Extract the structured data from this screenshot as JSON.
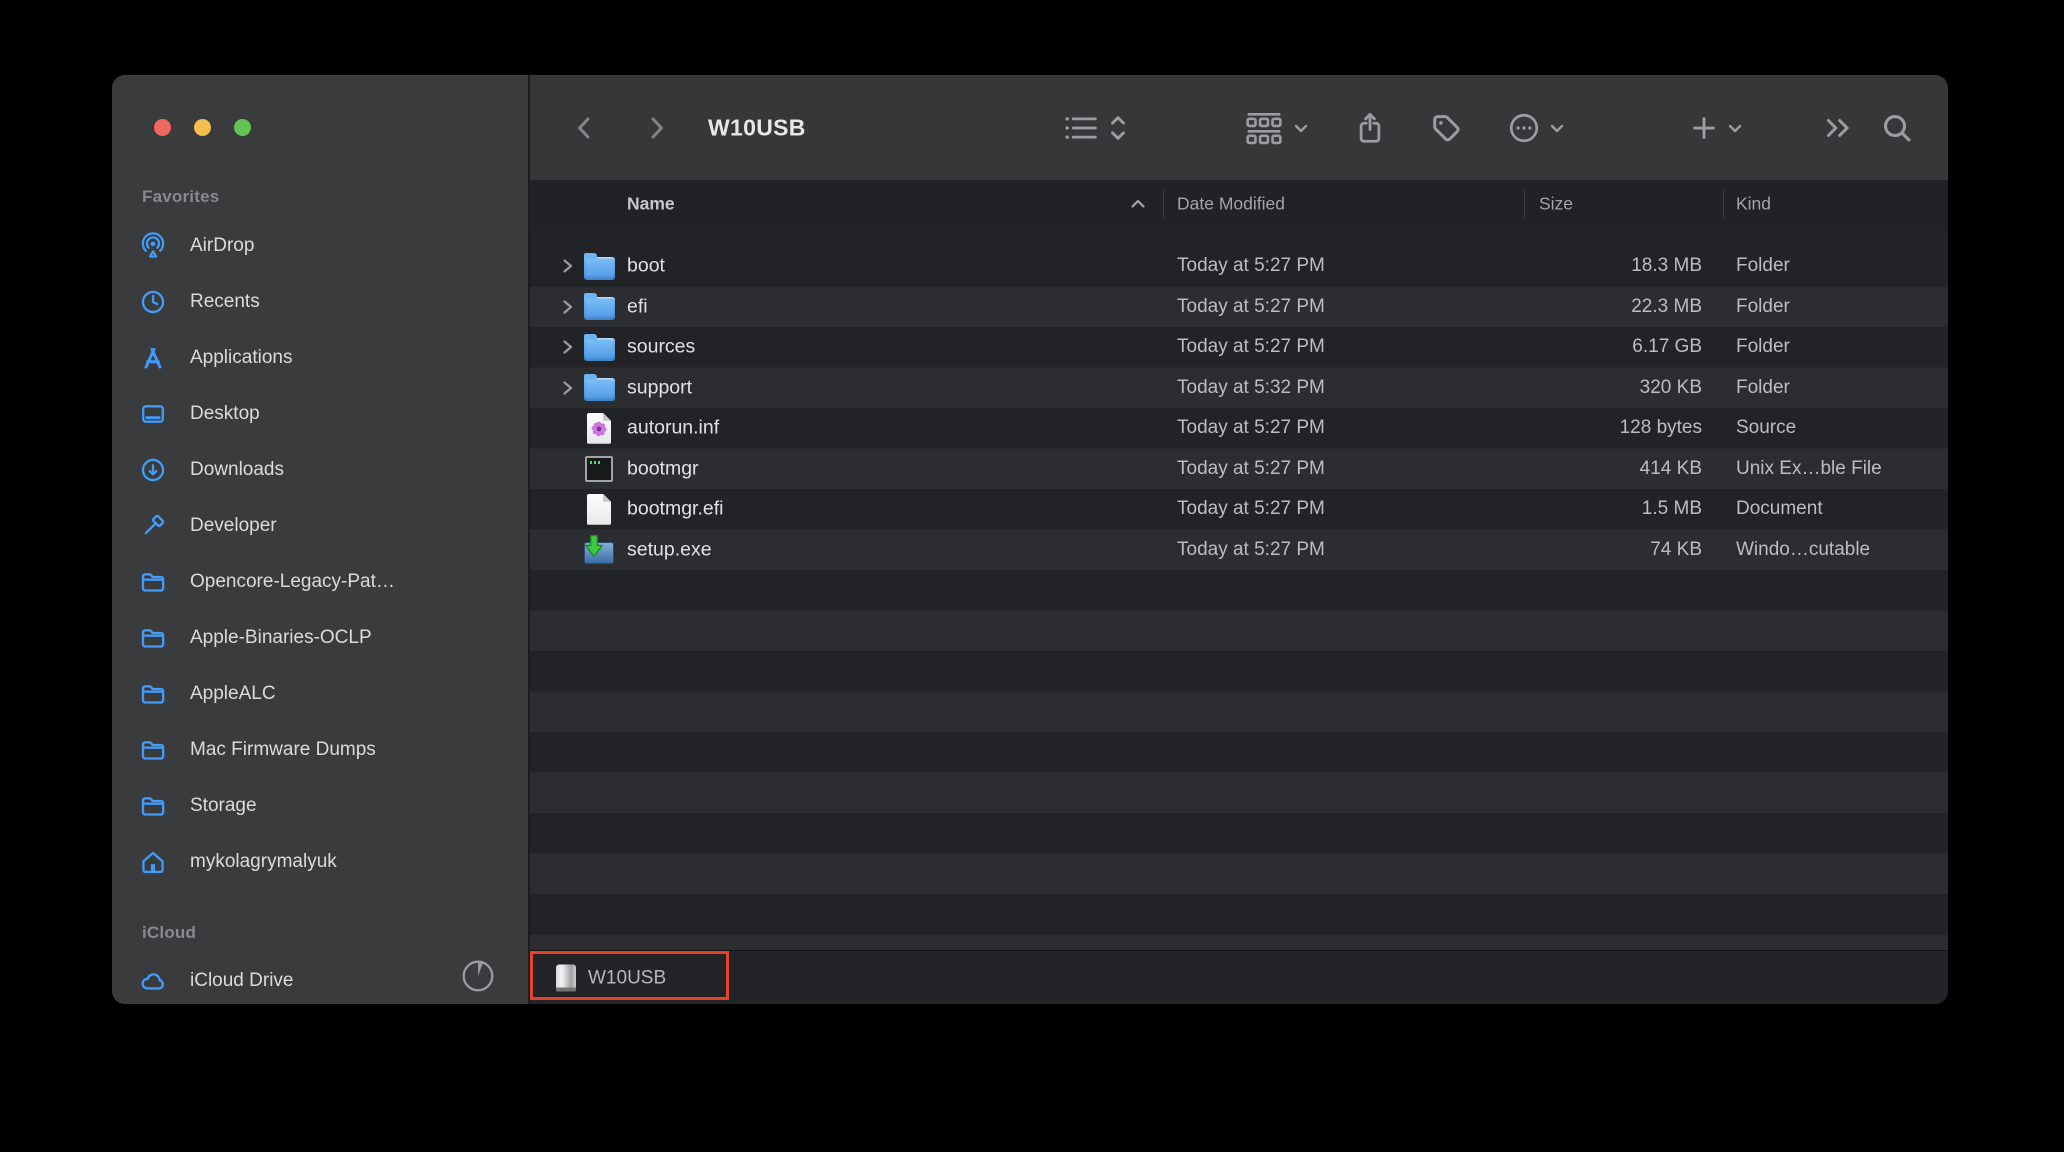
{
  "window": {
    "app": "Finder",
    "title": "W10USB"
  },
  "colors": {
    "accent-blue": "#419bf9",
    "annotation-red": "#e8432a",
    "traffic-red": "#ec6b5e",
    "traffic-yellow": "#f4bf50",
    "traffic-green": "#61c554",
    "folder-blue-top": "#7ec0f5",
    "folder-blue-bottom": "#4b97e6"
  },
  "toolbar": {
    "title": "W10USB",
    "controls": [
      "back",
      "forward",
      "view-list",
      "group-by",
      "share",
      "tag",
      "more-actions",
      "new-item",
      "overflow",
      "search"
    ]
  },
  "sidebar": {
    "sections": [
      {
        "header": "Favorites",
        "items": [
          {
            "label": "AirDrop",
            "icon": "airdrop-icon"
          },
          {
            "label": "Recents",
            "icon": "clock-icon"
          },
          {
            "label": "Applications",
            "icon": "appstore-icon"
          },
          {
            "label": "Desktop",
            "icon": "desktop-icon"
          },
          {
            "label": "Downloads",
            "icon": "download-circle-icon"
          },
          {
            "label": "Developer",
            "icon": "hammer-icon"
          },
          {
            "label": "Opencore-Legacy-Pat…",
            "icon": "folder-icon"
          },
          {
            "label": "Apple-Binaries-OCLP",
            "icon": "folder-icon"
          },
          {
            "label": "AppleALC",
            "icon": "folder-icon"
          },
          {
            "label": "Mac Firmware Dumps",
            "icon": "folder-icon"
          },
          {
            "label": "Storage",
            "icon": "folder-icon"
          },
          {
            "label": "mykolagrymalyuk",
            "icon": "home-icon"
          }
        ]
      },
      {
        "header": "iCloud",
        "items": [
          {
            "label": "iCloud Drive",
            "icon": "cloud-icon",
            "trailing": "sync-progress-icon"
          }
        ]
      }
    ]
  },
  "list": {
    "columns": [
      "Name",
      "Date Modified",
      "Size",
      "Kind"
    ],
    "sort": {
      "column": "Name",
      "direction": "ascending"
    },
    "rows": [
      {
        "name": "boot",
        "icon": "folder",
        "expandable": true,
        "date": "Today at 5:27 PM",
        "size": "18.3 MB",
        "kind": "Folder"
      },
      {
        "name": "efi",
        "icon": "folder",
        "expandable": true,
        "date": "Today at 5:27 PM",
        "size": "22.3 MB",
        "kind": "Folder"
      },
      {
        "name": "sources",
        "icon": "folder",
        "expandable": true,
        "date": "Today at 5:27 PM",
        "size": "6.17 GB",
        "kind": "Folder"
      },
      {
        "name": "support",
        "icon": "folder",
        "expandable": true,
        "date": "Today at 5:32 PM",
        "size": "320 KB",
        "kind": "Folder"
      },
      {
        "name": "autorun.inf",
        "icon": "inf-file",
        "expandable": false,
        "date": "Today at 5:27 PM",
        "size": "128 bytes",
        "kind": "Source"
      },
      {
        "name": "bootmgr",
        "icon": "exec-file",
        "expandable": false,
        "date": "Today at 5:27 PM",
        "size": "414 KB",
        "kind": "Unix Ex…ble File"
      },
      {
        "name": "bootmgr.efi",
        "icon": "document",
        "expandable": false,
        "date": "Today at 5:27 PM",
        "size": "1.5 MB",
        "kind": "Document"
      },
      {
        "name": "setup.exe",
        "icon": "installer",
        "expandable": false,
        "date": "Today at 5:27 PM",
        "size": "74 KB",
        "kind": "Windo…cutable"
      }
    ]
  },
  "statusbar": {
    "item_label": "W10USB",
    "item_icon": "disk-icon"
  },
  "annotation": {
    "type": "highlight-box",
    "target": "path-bar-device-item"
  }
}
